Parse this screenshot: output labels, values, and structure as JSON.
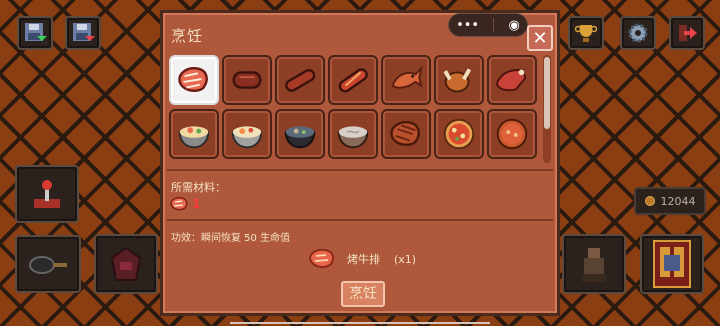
{
  "dialog": {
    "title": "烹饪",
    "mini_capsule": {
      "more_label": "•••",
      "record_label": "◉"
    },
    "close_label": "✕",
    "required_label": "所需材料：",
    "ingredient": {
      "icon": "raw-steak-icon",
      "count": "1"
    },
    "effect_text": "功效：瞬间恢复 50 生命值",
    "result": {
      "name": "烤牛排",
      "quantity": "(x1)",
      "icon": "grilled-steak-icon"
    },
    "cook_button_label": "烹饪",
    "recipes": [
      {
        "icon": "raw-steak-icon",
        "selected": true
      },
      {
        "icon": "sausage-icon",
        "selected": false
      },
      {
        "icon": "grilled-sausage-icon",
        "selected": false
      },
      {
        "icon": "hotdog-icon",
        "selected": false
      },
      {
        "icon": "fish-icon",
        "selected": false
      },
      {
        "icon": "roast-chicken-icon",
        "selected": false
      },
      {
        "icon": "ham-icon",
        "selected": false
      },
      {
        "icon": "noodle-soup-icon",
        "selected": false
      },
      {
        "icon": "noodle-soup-2-icon",
        "selected": false
      },
      {
        "icon": "dark-bowl-icon",
        "selected": false
      },
      {
        "icon": "porridge-icon",
        "selected": false
      },
      {
        "icon": "grilled-steak-icon",
        "selected": false
      },
      {
        "icon": "pizza-icon",
        "selected": false
      },
      {
        "icon": "tomato-soup-icon",
        "selected": false
      }
    ]
  },
  "hud": {
    "coins": "12044"
  },
  "colors": {
    "background": "#8a3e12",
    "lattice": "#2b1a10",
    "dialog_bg": "#b0583c",
    "slot_bg": "#8d3f26",
    "text": "#f5e3c4",
    "count_red": "#ff3838"
  }
}
